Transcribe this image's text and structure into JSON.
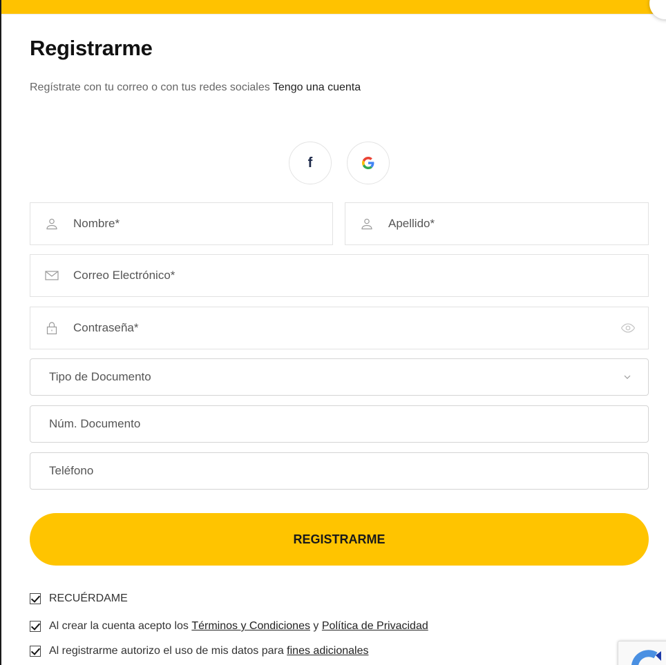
{
  "header": {
    "title": "Registrarme",
    "subtitle": "Regístrate con tu correo o con tus redes sociales",
    "login_link": "Tengo una cuenta"
  },
  "social": {
    "facebook_label": "f",
    "google_label": "G"
  },
  "form": {
    "first_name_placeholder": "Nombre*",
    "last_name_placeholder": "Apellido*",
    "email_placeholder": "Correo Electrónico*",
    "password_placeholder": "Contraseña*",
    "doc_type_selected": "Tipo de Documento",
    "doc_number_placeholder": "Núm. Documento",
    "phone_placeholder": "Teléfono",
    "submit_label": "REGISTRARME"
  },
  "checks": {
    "remember_label": "RECUÉRDAME",
    "terms_prefix": "Al crear la cuenta acepto los",
    "terms_link": "Términos y Condiciones",
    "terms_and": "y",
    "privacy_link": "Política de Privacidad",
    "data_prefix": "Al registrarme autorizo el uso de mis datos para",
    "data_link": "fines adicionales"
  },
  "colors": {
    "accent": "#ffc400",
    "google_blue": "#4285F4",
    "google_red": "#EA4335",
    "google_yellow": "#FBBC05",
    "google_green": "#34A853"
  },
  "icons": {
    "first_name": "user-icon",
    "last_name": "user-icon",
    "email": "mail-icon",
    "password": "lock-icon",
    "password_toggle": "eye-icon",
    "doc_type": "chevron-down-icon",
    "recaptcha": "recaptcha-icon"
  }
}
